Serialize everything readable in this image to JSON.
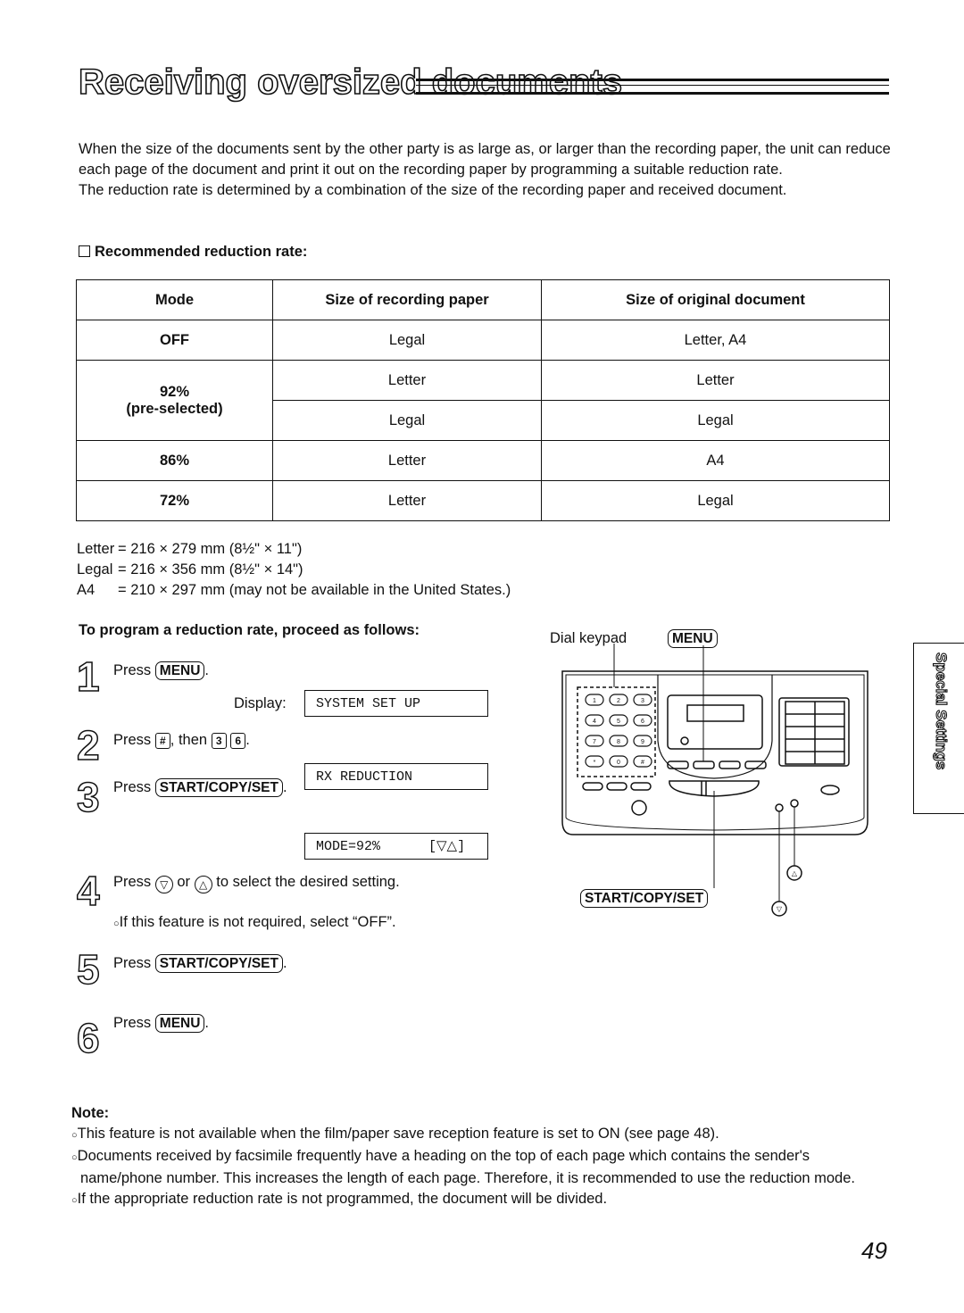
{
  "title": "Receiving oversized documents",
  "intro": [
    "When the size of the documents sent by the other party is as large as, or larger than the recording paper, the unit can reduce each page of the document and print it out on the recording paper by programming a suitable reduction rate.",
    "The reduction rate is determined by a combination of the size of the recording paper and received document."
  ],
  "recommended_heading": "Recommended reduction rate:",
  "table": {
    "headers": [
      "Mode",
      "Size of recording paper",
      "Size of original document"
    ],
    "rows": [
      {
        "mode": "OFF",
        "recording": "Legal",
        "original": "Letter, A4"
      },
      {
        "mode": "92%",
        "mode_note": "(pre-selected)",
        "recording": "Letter",
        "original": "Letter"
      },
      {
        "mode": "",
        "recording": "Legal",
        "original": "Legal"
      },
      {
        "mode": "86%",
        "recording": "Letter",
        "original": "A4"
      },
      {
        "mode": "72%",
        "recording": "Letter",
        "original": "Legal"
      }
    ]
  },
  "sizes": [
    {
      "label": "Letter",
      "value": "= 216 × 279 mm (8½\" × 11\")"
    },
    {
      "label": "Legal",
      "value": "= 216 × 356 mm (8½\" × 14\")"
    },
    {
      "label": "A4",
      "value": "= 210 × 297 mm (may not be available in the United States.)"
    }
  ],
  "program_heading": "To program a reduction rate, proceed as follows:",
  "steps": [
    {
      "num": "1",
      "press": "Press",
      "key": "MENU",
      "display_label": "Display:",
      "display": "SYSTEM SET UP"
    },
    {
      "num": "2",
      "press": "Press",
      "key1": "#",
      "then": ", then",
      "key2": "3",
      "key3": "6",
      "display": "RX REDUCTION"
    },
    {
      "num": "3",
      "press": "Press",
      "key": "START/COPY/SET",
      "display": "MODE=92%      [▽△]"
    },
    {
      "num": "4",
      "press": "Press",
      "key_down": "▽",
      "or": "or",
      "key_up": "△",
      "rest": "to select the desired setting.",
      "bullet": "If this feature is not required, select “OFF”."
    },
    {
      "num": "5",
      "press": "Press",
      "key": "START/COPY/SET"
    },
    {
      "num": "6",
      "press": "Press",
      "key": "MENU"
    }
  ],
  "diagram": {
    "dial_keypad_label": "Dial keypad",
    "menu_label": "MENU",
    "start_label": "START/COPY/SET",
    "up_label": "△",
    "down_label": "▽",
    "keypad_keys": [
      "1",
      "2",
      "3",
      "4",
      "5",
      "6",
      "7",
      "8",
      "9",
      "*",
      "0",
      "#"
    ]
  },
  "side_tab": "Special Settings",
  "note": {
    "heading": "Note:",
    "items": [
      "This feature is not available when the film/paper save reception feature is set to ON (see page 48).",
      "Documents received by facsimile frequently have a heading on the top of each page which contains the sender's name/phone number. This increases the length of each page. Therefore, it is recommended to use the reduction mode.",
      "If the appropriate reduction rate is not programmed, the document will be divided."
    ]
  },
  "page_number": "49"
}
